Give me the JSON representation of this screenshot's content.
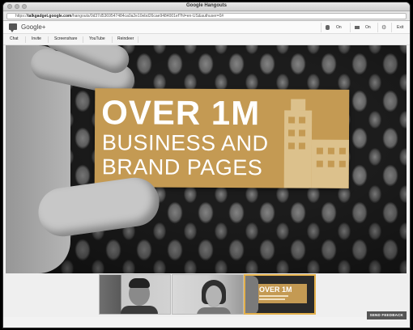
{
  "window": {
    "title": "Google Hangouts"
  },
  "address_bar": {
    "scheme": "https://",
    "host": "talkgadget.google.com",
    "path": "/hangouts/0d37d5369547484ca0a2e10ebd26cae9484001ef?hl=en-US&authuser=0#"
  },
  "header": {
    "logo_text": "Google+",
    "mic_state": "On",
    "camera_state": "On",
    "exit_label": "Exit"
  },
  "toolbar": {
    "items": [
      "Chat",
      "Invite",
      "Screenshare",
      "YouTube",
      "Reindeer"
    ]
  },
  "main_video": {
    "sign_line1": "OVER 1M",
    "sign_line2": "BUSINESS AND",
    "sign_line3": "BRAND PAGES",
    "sign_color": "#c49a53"
  },
  "thumbnails": {
    "selected_index": 2,
    "selected_border_color": "#e3b04b",
    "preview_line1": "OVER 1M"
  },
  "feedback_label": "SEND FEEDBACK"
}
